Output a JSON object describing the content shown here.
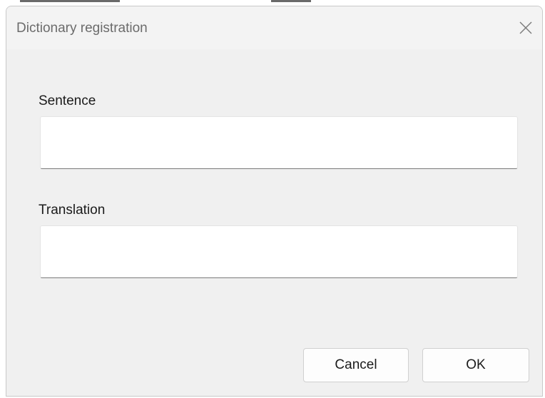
{
  "dialog": {
    "title": "Dictionary registration",
    "close_icon": "close-icon"
  },
  "fields": {
    "sentence": {
      "label": "Sentence",
      "value": "",
      "placeholder": ""
    },
    "translation": {
      "label": "Translation",
      "value": "",
      "placeholder": ""
    }
  },
  "buttons": {
    "cancel_label": "Cancel",
    "ok_label": "OK"
  },
  "colors": {
    "dialog_background": "#f0f0f0",
    "field_background": "#ffffff",
    "field_underline": "#7a7a7a",
    "title_text": "#6b6b6b"
  }
}
